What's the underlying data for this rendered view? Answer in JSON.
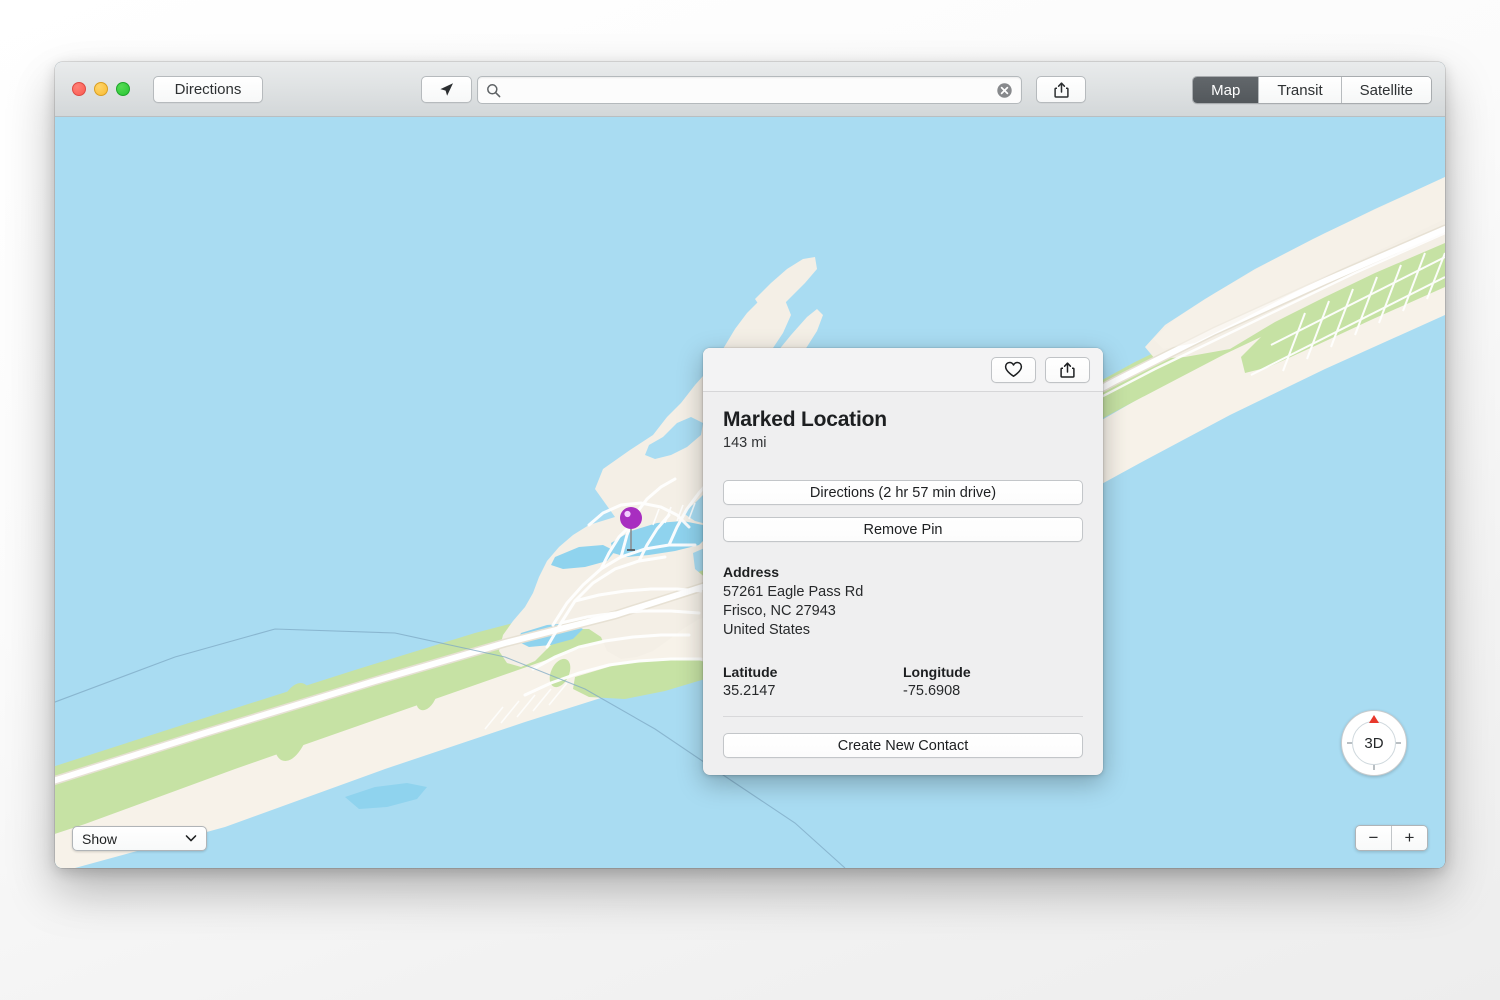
{
  "window": {
    "traffic_lights": [
      "close",
      "minimize",
      "zoom"
    ]
  },
  "toolbar": {
    "directions_label": "Directions",
    "locate_icon": "location-arrow-icon",
    "search": {
      "placeholder": "",
      "value": "",
      "search_icon": "search-icon",
      "clear_icon": "clear-circle-icon"
    },
    "share_icon": "share-icon",
    "segmented": {
      "options": [
        "Map",
        "Transit",
        "Satellite"
      ],
      "selected": "Map",
      "selected_bg": "#53585c",
      "selected_fg": "#ffffff"
    }
  },
  "map": {
    "colors": {
      "water": "#a9dcf2",
      "land": "#f4efe6",
      "green": "#c6e2a4",
      "beach": "#f7f2e9",
      "road": "#ffffff",
      "road_casing": "#e2ddd2",
      "boundary": "#7fa9c4"
    },
    "pin": {
      "label": "map-pin",
      "color": "#a82ec0",
      "highlight": "#f2c6ff",
      "stem_color": "#8c8f92"
    },
    "show_popup": {
      "label": "Show",
      "chevron": "chevron-down-icon"
    },
    "compass": {
      "label": "3D",
      "north_color": "#e8382c"
    },
    "zoom_controls": {
      "zoom_out": "−",
      "zoom_in": "+"
    }
  },
  "popover": {
    "favorite_icon": "heart-icon",
    "share_icon": "share-icon",
    "title": "Marked Location",
    "distance": "143 mi",
    "directions_button": "Directions (2 hr 57 min drive)",
    "remove_pin_button": "Remove Pin",
    "address": {
      "label": "Address",
      "lines": [
        "57261 Eagle Pass Rd",
        "Frisco, NC  27943",
        "United States"
      ]
    },
    "latitude": {
      "label": "Latitude",
      "value": "35.2147"
    },
    "longitude": {
      "label": "Longitude",
      "value": "-75.6908"
    },
    "create_contact_button": "Create New Contact"
  }
}
